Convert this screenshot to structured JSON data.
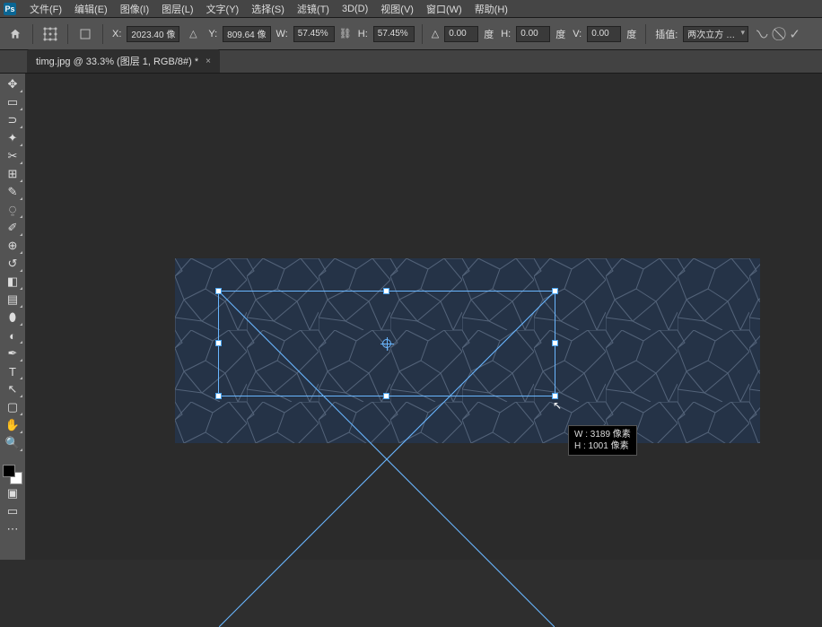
{
  "menu": {
    "items": [
      "文件(F)",
      "编辑(E)",
      "图像(I)",
      "图层(L)",
      "文字(Y)",
      "选择(S)",
      "滤镜(T)",
      "3D(D)",
      "视图(V)",
      "窗口(W)",
      "帮助(H)"
    ]
  },
  "options": {
    "x_label": "X:",
    "x_value": "2023.40 像",
    "y_label": "Y:",
    "y_value": "809.64 像",
    "w_label": "W:",
    "w_value": "57.45%",
    "h_label": "H:",
    "h_value": "57.45%",
    "rot_label": "△",
    "rot_value": "0.00",
    "rot_unit": "度",
    "skewh_label": "H:",
    "skewh_value": "0.00",
    "skewh_unit": "度",
    "skewv_label": "V:",
    "skewv_value": "0.00",
    "skewv_unit": "度",
    "interp_label": "插值:",
    "interp_value": "两次立方 …"
  },
  "tab": {
    "title": "timg.jpg @ 33.3% (图层 1, RGB/8#) *"
  },
  "tooltip": {
    "w_label": "W :",
    "w_value": "3189 像素",
    "h_label": "H :",
    "h_value": "1001 像素"
  },
  "tools": [
    {
      "name": "move-tool",
      "glyph": "✥"
    },
    {
      "name": "marquee-tool",
      "glyph": "▭"
    },
    {
      "name": "lasso-tool",
      "glyph": "⊃"
    },
    {
      "name": "magic-wand-tool",
      "glyph": "✦"
    },
    {
      "name": "crop-tool",
      "glyph": "✂"
    },
    {
      "name": "frame-tool",
      "glyph": "⊞"
    },
    {
      "name": "eyedropper-tool",
      "glyph": "✎"
    },
    {
      "name": "healing-brush-tool",
      "glyph": "⍜"
    },
    {
      "name": "brush-tool",
      "glyph": "✐"
    },
    {
      "name": "clone-stamp-tool",
      "glyph": "⊕"
    },
    {
      "name": "history-brush-tool",
      "glyph": "↺"
    },
    {
      "name": "eraser-tool",
      "glyph": "◧"
    },
    {
      "name": "gradient-tool",
      "glyph": "▤"
    },
    {
      "name": "blur-tool",
      "glyph": "⬮"
    },
    {
      "name": "dodge-tool",
      "glyph": "◐"
    },
    {
      "name": "pen-tool",
      "glyph": "✒"
    },
    {
      "name": "type-tool",
      "glyph": "T"
    },
    {
      "name": "path-select-tool",
      "glyph": "↖"
    },
    {
      "name": "shape-tool",
      "glyph": "▢"
    },
    {
      "name": "hand-tool",
      "glyph": "✋"
    },
    {
      "name": "zoom-tool",
      "glyph": "🔍"
    }
  ]
}
